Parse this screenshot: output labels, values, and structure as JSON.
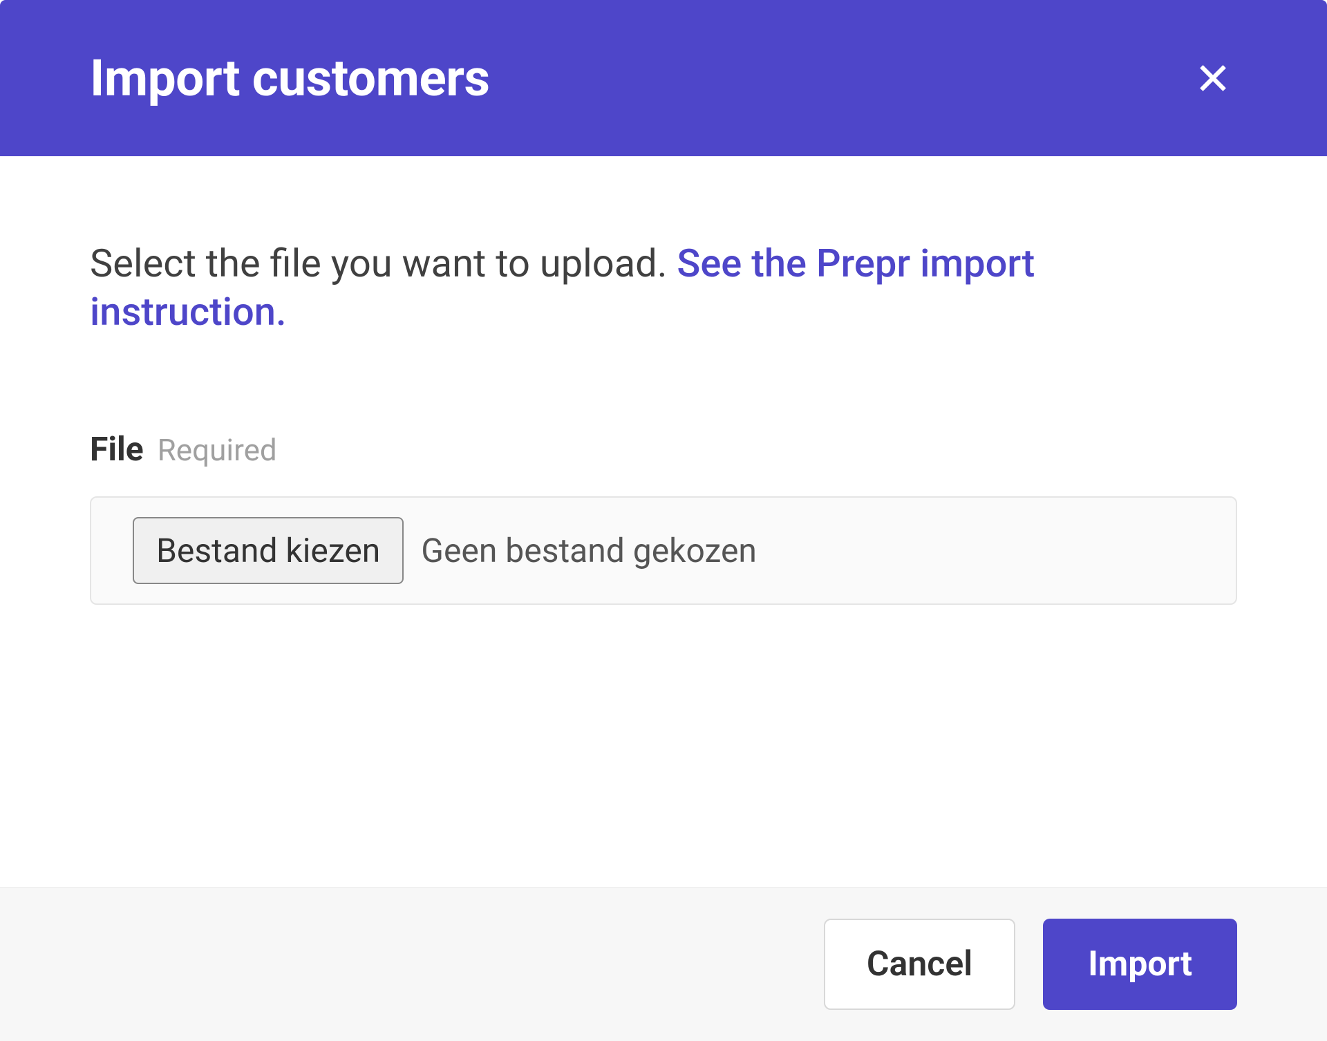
{
  "modal": {
    "title": "Import customers",
    "instruction_text": "Select the file you want to upload. ",
    "instruction_link": "See the Prepr import instruction.",
    "file": {
      "label": "File",
      "required_label": "Required",
      "choose_button": "Bestand kiezen",
      "status_text": "Geen bestand gekozen"
    },
    "footer": {
      "cancel_label": "Cancel",
      "import_label": "Import"
    }
  },
  "colors": {
    "primary": "#4E46C9"
  }
}
